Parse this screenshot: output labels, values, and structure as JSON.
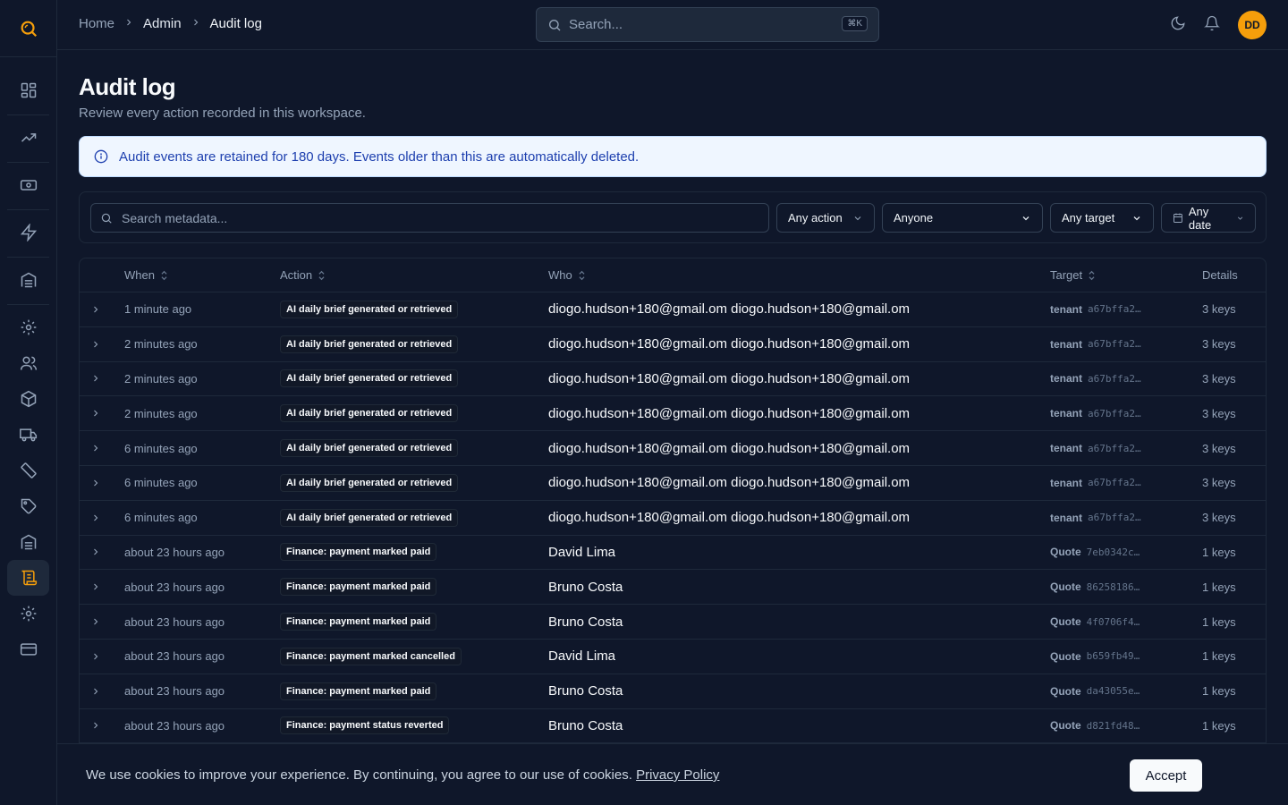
{
  "breadcrumb": {
    "home": "Home",
    "admin": "Admin",
    "current": "Audit log"
  },
  "top_search": {
    "placeholder": "Search...",
    "shortcut": "⌘K"
  },
  "user": {
    "initials": "DD"
  },
  "page": {
    "title": "Audit log",
    "subtitle": "Review every action recorded in this workspace."
  },
  "notice": {
    "text": "Audit events are retained for 180 days. Events older than this are automatically deleted."
  },
  "filters": {
    "search_placeholder": "Search metadata...",
    "action": "Any action",
    "who": "Anyone",
    "target": "Any target",
    "date": "Any date"
  },
  "table": {
    "headers": {
      "when": "When",
      "action": "Action",
      "who": "Who",
      "target": "Target",
      "details": "Details"
    },
    "rows": [
      {
        "when": "1 minute ago",
        "action": "AI daily brief generated or retrieved",
        "who": "diogo.hudson+180@gmail.om diogo.hudson+180@gmail.om",
        "target_type": "tenant",
        "target_id": "a67bffa2…",
        "details": "3 keys"
      },
      {
        "when": "2 minutes ago",
        "action": "AI daily brief generated or retrieved",
        "who": "diogo.hudson+180@gmail.om diogo.hudson+180@gmail.om",
        "target_type": "tenant",
        "target_id": "a67bffa2…",
        "details": "3 keys"
      },
      {
        "when": "2 minutes ago",
        "action": "AI daily brief generated or retrieved",
        "who": "diogo.hudson+180@gmail.om diogo.hudson+180@gmail.om",
        "target_type": "tenant",
        "target_id": "a67bffa2…",
        "details": "3 keys"
      },
      {
        "when": "2 minutes ago",
        "action": "AI daily brief generated or retrieved",
        "who": "diogo.hudson+180@gmail.om diogo.hudson+180@gmail.om",
        "target_type": "tenant",
        "target_id": "a67bffa2…",
        "details": "3 keys"
      },
      {
        "when": "6 minutes ago",
        "action": "AI daily brief generated or retrieved",
        "who": "diogo.hudson+180@gmail.om diogo.hudson+180@gmail.om",
        "target_type": "tenant",
        "target_id": "a67bffa2…",
        "details": "3 keys"
      },
      {
        "when": "6 minutes ago",
        "action": "AI daily brief generated or retrieved",
        "who": "diogo.hudson+180@gmail.om diogo.hudson+180@gmail.om",
        "target_type": "tenant",
        "target_id": "a67bffa2…",
        "details": "3 keys"
      },
      {
        "when": "6 minutes ago",
        "action": "AI daily brief generated or retrieved",
        "who": "diogo.hudson+180@gmail.om diogo.hudson+180@gmail.om",
        "target_type": "tenant",
        "target_id": "a67bffa2…",
        "details": "3 keys"
      },
      {
        "when": "about 23 hours ago",
        "action": "Finance: payment marked paid",
        "who": "David Lima",
        "target_type": "Quote",
        "target_id": "7eb0342c…",
        "details": "1 keys"
      },
      {
        "when": "about 23 hours ago",
        "action": "Finance: payment marked paid",
        "who": "Bruno Costa",
        "target_type": "Quote",
        "target_id": "86258186…",
        "details": "1 keys"
      },
      {
        "when": "about 23 hours ago",
        "action": "Finance: payment marked paid",
        "who": "Bruno Costa",
        "target_type": "Quote",
        "target_id": "4f0706f4…",
        "details": "1 keys"
      },
      {
        "when": "about 23 hours ago",
        "action": "Finance: payment marked cancelled",
        "who": "David Lima",
        "target_type": "Quote",
        "target_id": "b659fb49…",
        "details": "1 keys"
      },
      {
        "when": "about 23 hours ago",
        "action": "Finance: payment marked paid",
        "who": "Bruno Costa",
        "target_type": "Quote",
        "target_id": "da43055e…",
        "details": "1 keys"
      },
      {
        "when": "about 23 hours ago",
        "action": "Finance: payment status reverted",
        "who": "Bruno Costa",
        "target_type": "Quote",
        "target_id": "d821fd48…",
        "details": "1 keys"
      }
    ]
  },
  "cookie": {
    "text": "We use cookies to improve your experience. By continuing, you agree to our use of cookies. ",
    "link": "Privacy Policy",
    "accept": "Accept"
  },
  "colors": {
    "accent": "#f59e0b",
    "background": "#0f172a",
    "notice_bg": "#eff6ff",
    "notice_text": "#1e40af"
  },
  "icons": [
    "logo-search-icon",
    "dashboard-icon",
    "trending-icon",
    "money-icon",
    "bolt-icon",
    "warehouse-icon",
    "settings-cog-icon",
    "users-icon",
    "box-icon",
    "truck-icon",
    "ruler-icon",
    "tag-icon",
    "warehouse-icon",
    "scroll-icon",
    "gear-icon",
    "credit-card-icon"
  ]
}
